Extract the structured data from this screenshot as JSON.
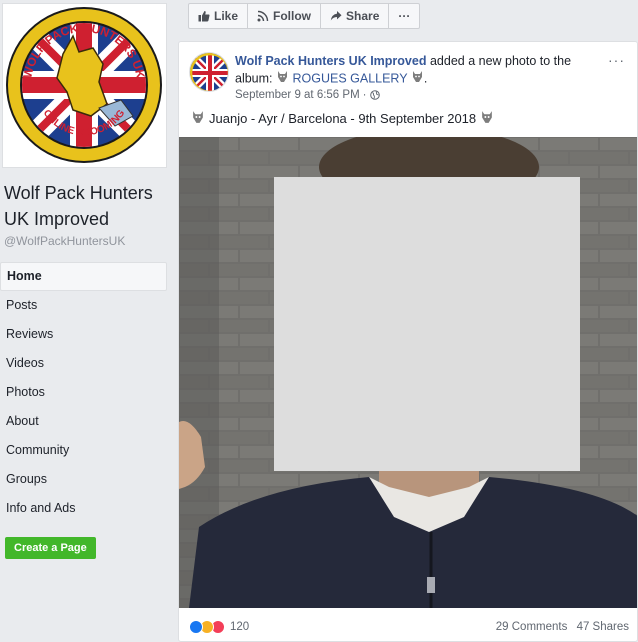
{
  "page": {
    "name": "Wolf Pack Hunters UK Improved",
    "handle": "@WolfPackHuntersUK",
    "logo_text_top": "WOLF PACK HUNTERS UK",
    "logo_text_bottom": "ONLINE GROOMING"
  },
  "nav": {
    "items": [
      {
        "label": "Home",
        "active": true
      },
      {
        "label": "Posts"
      },
      {
        "label": "Reviews"
      },
      {
        "label": "Videos"
      },
      {
        "label": "Photos"
      },
      {
        "label": "About"
      },
      {
        "label": "Community"
      },
      {
        "label": "Groups"
      },
      {
        "label": "Info and Ads"
      }
    ],
    "create_page_label": "Create a Page"
  },
  "actions": {
    "like_label": "Like",
    "follow_label": "Follow",
    "share_label": "Share",
    "more_label": "···"
  },
  "post": {
    "author": "Wolf Pack Hunters UK Improved",
    "action_text": " added a new photo to the album: ",
    "album_name": "ROGUES GALLERY",
    "album_suffix": ".",
    "timestamp": "September 9 at 6:56 PM",
    "meta_separator": "·",
    "options_label": "···",
    "caption": "Juanjo - Ayr / Barcelona - 9th September 2018",
    "reaction_count": "120",
    "comments": "29 Comments",
    "shares": "47 Shares"
  },
  "icons": {
    "like": "thumbs-up-icon",
    "follow": "rss-icon",
    "share": "share-arrow-icon",
    "privacy": "globe-icon",
    "wolf": "wolf-emoji-icon"
  },
  "colors": {
    "link": "#365899",
    "create_button": "#42b72a",
    "background": "#e9ebee"
  }
}
